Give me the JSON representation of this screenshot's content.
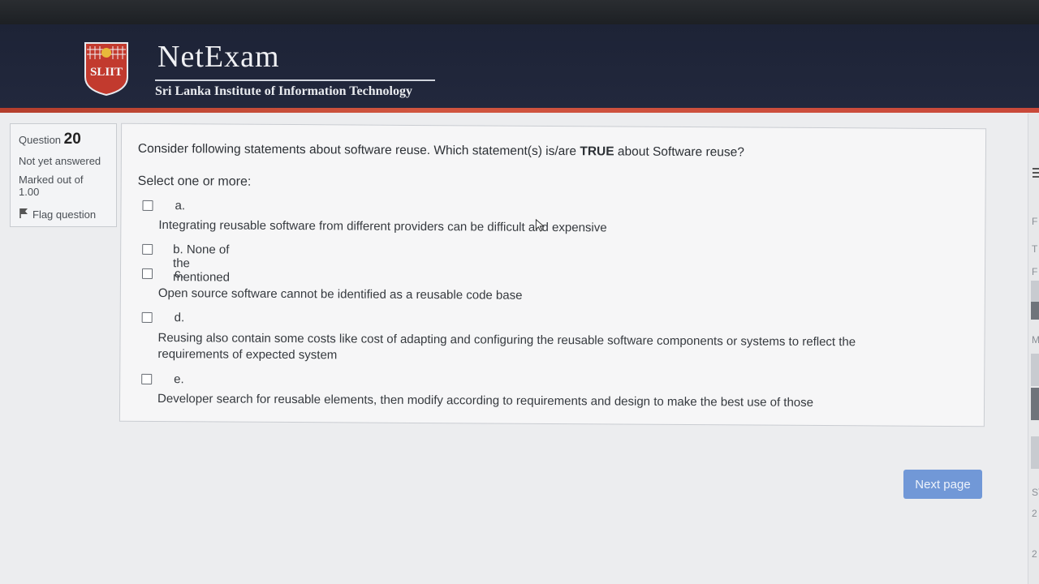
{
  "header": {
    "logo_text": "SLIIT",
    "title": "NetExam",
    "subtitle": "Sri Lanka Institute of Information Technology"
  },
  "question_info": {
    "question_label": "Question",
    "question_number": "20",
    "status": "Not yet answered",
    "marked_out_of": "Marked out of",
    "marks": "1.00",
    "flag_label": "Flag question"
  },
  "question": {
    "text_before": "Consider following statements about software reuse. Which statement(s) is/are ",
    "text_bold": "TRUE",
    "text_after": " about Software reuse?",
    "select_label": "Select one or more:",
    "options": [
      {
        "letter": "a.",
        "text": "Integrating reusable software from different providers can be difficult and expensive"
      },
      {
        "letter": "b.",
        "text": "None of the mentioned"
      },
      {
        "letter": "c.",
        "text": "Open source software cannot be identified as a reusable code base"
      },
      {
        "letter": "d.",
        "text": "Reusing also contain some costs like cost of adapting and configuring the reusable software components or systems to reflect the requirements of expected system"
      },
      {
        "letter": "e.",
        "text": "Developer search for reusable elements, then modify according to requirements and design to make the best use of those"
      }
    ]
  },
  "next_button": "Next page",
  "edge_letters": [
    "F",
    "T",
    "F",
    "M",
    "ST",
    "2",
    "2"
  ],
  "colors": {
    "header_bg": "#1d2336",
    "accent_red": "#c9493a",
    "button_blue": "#7198d7"
  }
}
